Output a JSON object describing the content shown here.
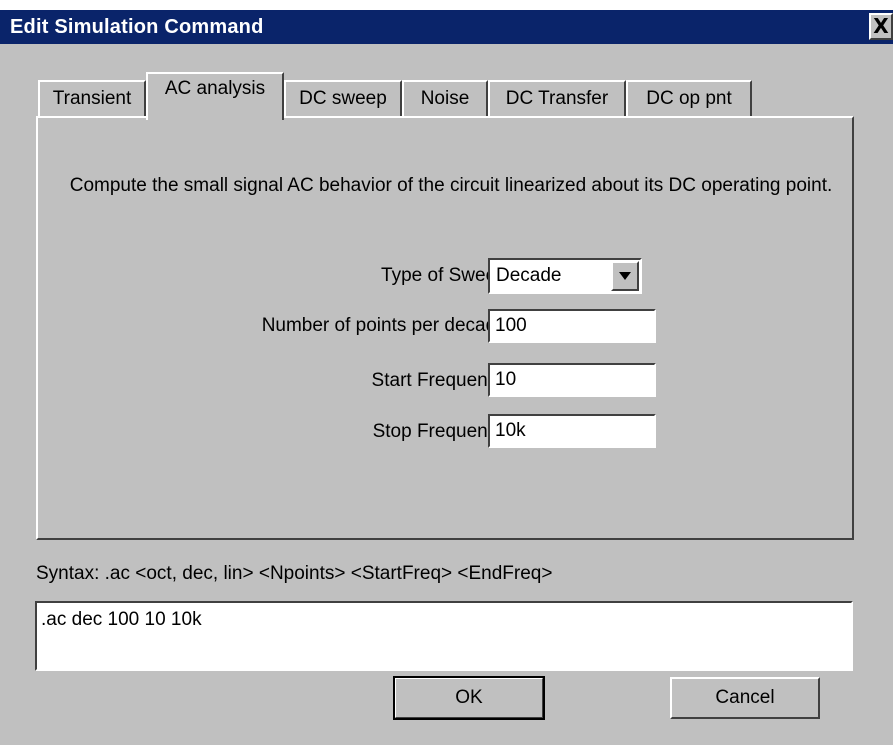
{
  "window": {
    "title": "Edit Simulation Command",
    "close_glyph": "X"
  },
  "tabs": [
    {
      "label": "Transient",
      "active": false
    },
    {
      "label": "AC analysis",
      "active": true
    },
    {
      "label": "DC sweep",
      "active": false
    },
    {
      "label": "Noise",
      "active": false
    },
    {
      "label": "DC Transfer",
      "active": false
    },
    {
      "label": "DC op pnt",
      "active": false
    }
  ],
  "panel": {
    "description": "Compute the small signal AC behavior of the circuit linearized about its DC operating point.",
    "sweep_type": {
      "label": "Type of Sweep:",
      "value": "Decade"
    },
    "points": {
      "label": "Number of points per decade:",
      "value": "100"
    },
    "start_freq": {
      "label": "Start Frequency:",
      "value": "10"
    },
    "stop_freq": {
      "label": "Stop Frequency:",
      "value": "10k"
    }
  },
  "syntax": "Syntax:  .ac <oct, dec, lin> <Npoints> <StartFreq> <EndFreq>",
  "command": ".ac dec 100 10 10k",
  "buttons": {
    "ok": "OK",
    "cancel": "Cancel"
  },
  "colors": {
    "titlebar": "#0a246a",
    "face": "#c0c0c0"
  }
}
